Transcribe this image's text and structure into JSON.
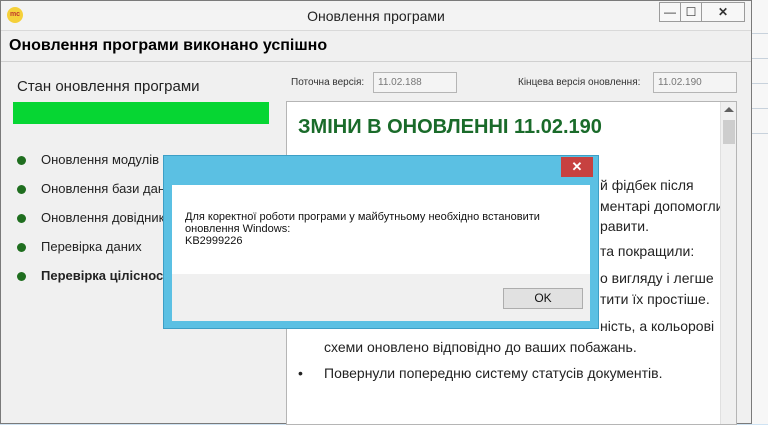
{
  "window": {
    "icon_text": "mc",
    "title": "Оновлення програми",
    "controls": {
      "minimize": "—",
      "maximize": "☐",
      "close": "✕"
    }
  },
  "headline": "Оновлення програми виконано успішно",
  "status": {
    "title": "Стан оновлення програми",
    "progress": 1.0,
    "steps": [
      {
        "label": "Оновлення модулів програми",
        "bold": false
      },
      {
        "label": "Оновлення бази даних",
        "bold": false
      },
      {
        "label": "Оновлення довідників",
        "bold": false
      },
      {
        "label": "Перевірка даних",
        "bold": false
      },
      {
        "label": "Перевірка цілісності",
        "bold": true
      }
    ]
  },
  "versions": {
    "current_label": "Поточна версія:",
    "current_value": "11.02.188",
    "final_label": "Кінцева версія оновлення:",
    "final_value": "11.02.190"
  },
  "notes": {
    "title": "ЗМІНИ В ОНОВЛЕННІ 11.02.190",
    "fragments": [
      "й фідбек після",
      "ментарі допомогли",
      "равити.",
      "та покращили:",
      "о вигляду і легше",
      "тити їх простіше.",
      "ність, а кольорові",
      "схеми оновлено відповідно до ваших побажань.",
      "•",
      "Повернули попередню систему статусів документів."
    ]
  },
  "dialog": {
    "close": "✕",
    "line1": "Для коректної роботи програми у майбутньому необхідно встановити",
    "line2": "оновлення Windows:",
    "line3": "KB2999226",
    "ok": "OK"
  }
}
